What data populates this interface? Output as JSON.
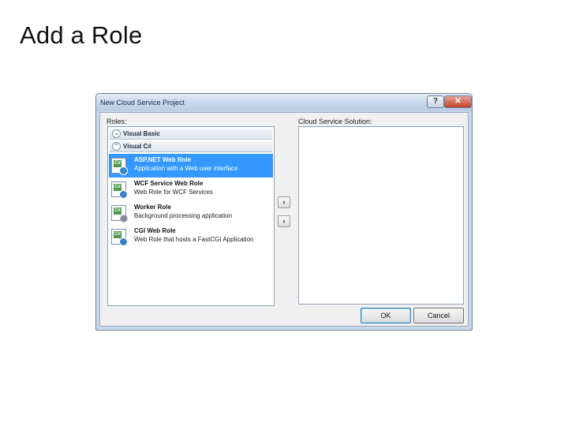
{
  "slide": {
    "title": "Add a Role"
  },
  "dialog": {
    "title": "New Cloud Service Project",
    "help_glyph": "?",
    "close_glyph": "✕",
    "roles_label": "Roles:",
    "solution_label": "Cloud Service Solution:",
    "groups": [
      {
        "label": "Visual Basic",
        "state": "collapsed",
        "chevron": "⌄"
      },
      {
        "label": "Visual C#",
        "state": "expanded",
        "chevron": "⌃"
      }
    ],
    "roles": [
      {
        "name": "ASP.NET Web Role",
        "description": "Application with a Web user interface",
        "selected": true,
        "icon": "aspnet-web-role-icon"
      },
      {
        "name": "WCF Service Web Role",
        "description": "Web Role for WCF Services",
        "selected": false,
        "icon": "wcf-service-web-role-icon"
      },
      {
        "name": "Worker Role",
        "description": "Background processing application",
        "selected": false,
        "icon": "worker-role-icon"
      },
      {
        "name": "CGI Web Role",
        "description": "Web Role that hosts a FastCGI Application",
        "selected": false,
        "icon": "cgi-web-role-icon"
      }
    ],
    "icon_badge_text": "C#",
    "add_arrow": "›",
    "remove_arrow": "‹",
    "ok_label": "OK",
    "cancel_label": "Cancel",
    "colors": {
      "selection": "#3399ff",
      "titlebar": "#c4d5ea",
      "close_button": "#c2412a"
    }
  }
}
